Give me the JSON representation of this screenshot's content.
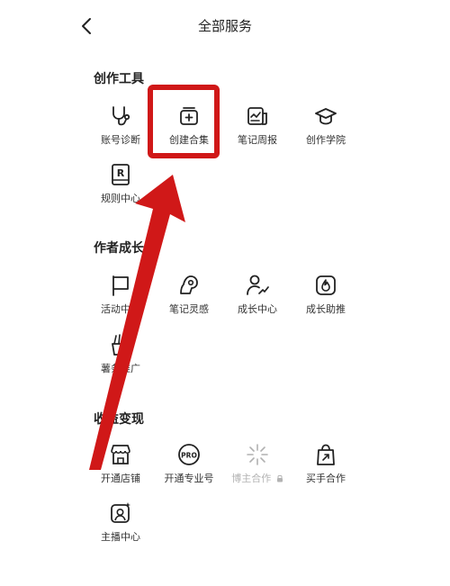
{
  "header": {
    "title": "全部服务"
  },
  "sections": [
    {
      "title": "创作工具",
      "items": [
        {
          "label": "账号诊断",
          "icon": "stethoscope-icon"
        },
        {
          "label": "创建合集",
          "icon": "collection-add-icon"
        },
        {
          "label": "笔记周报",
          "icon": "weekly-report-icon"
        },
        {
          "label": "创作学院",
          "icon": "graduation-cap-icon"
        },
        {
          "label": "规则中心",
          "icon": "rule-book-icon"
        }
      ]
    },
    {
      "title": "作者成长",
      "items": [
        {
          "label": "活动中心",
          "icon": "flag-icon"
        },
        {
          "label": "笔记灵感",
          "icon": "lightbulb-icon"
        },
        {
          "label": "成长中心",
          "icon": "user-growth-icon"
        },
        {
          "label": "成长助推",
          "icon": "flame-icon"
        },
        {
          "label": "薯条推广",
          "icon": "fries-icon"
        }
      ]
    },
    {
      "title": "收益变现",
      "items": [
        {
          "label": "开通店铺",
          "icon": "store-icon"
        },
        {
          "label": "开通专业号",
          "icon": "pro-badge-icon"
        },
        {
          "label": "博主合作",
          "icon": "sparkle-icon",
          "locked": true
        },
        {
          "label": "买手合作",
          "icon": "shopping-bag-icon"
        },
        {
          "label": "主播中心",
          "icon": "streamer-icon"
        }
      ]
    }
  ],
  "colors": {
    "highlight": "#d01818",
    "text": "#222222",
    "disabled": "#b3b3b3"
  }
}
